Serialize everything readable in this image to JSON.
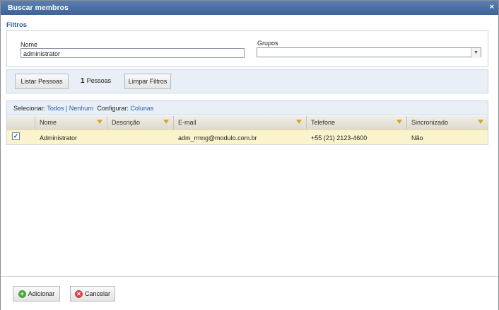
{
  "window": {
    "title": "Buscar membros",
    "close": "×"
  },
  "filters": {
    "section_title": "Filtros",
    "name_label": "Nome",
    "name_value": "administrator",
    "groups_label": "Grupos",
    "groups_value": ""
  },
  "actions": {
    "list_button": "Listar Pessoas",
    "count": "1",
    "count_label": "Pessoas",
    "clear_button": "Limpar Filtros"
  },
  "grid": {
    "select_label": "Selecionar:",
    "select_all": "Todos",
    "separator": "|",
    "select_none": "Nenhum",
    "configure_label": "Configurar:",
    "configure_columns": "Colunas",
    "columns": [
      "Nome",
      "Descrição",
      "E-mail",
      "Telefone",
      "Sincronizado"
    ],
    "rows": [
      {
        "checked": true,
        "nome": "Administrator",
        "descricao": "",
        "email": "adm_rmng@modulo.com.br",
        "telefone": "+55 (21) 2123-4600",
        "sincronizado": "Não"
      }
    ]
  },
  "footer": {
    "add_button": "Adicionar",
    "cancel_button": "Cancelar"
  },
  "colors": {
    "title_bar": "#3e6296",
    "accent": "#2c5a9a",
    "selected_row": "#fbf3cc"
  },
  "icons": {
    "close": "close-icon",
    "filter": "funnel-icon",
    "add": "add-icon",
    "cancel": "cancel-icon"
  }
}
